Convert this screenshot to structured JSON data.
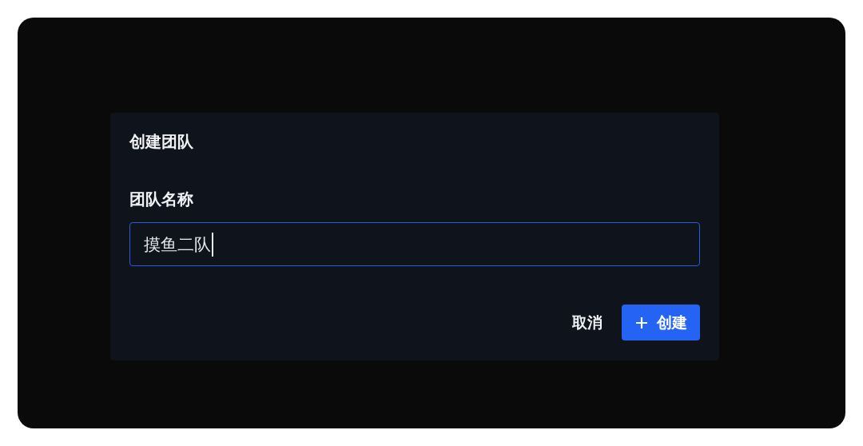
{
  "dialog": {
    "title": "创建团队",
    "field": {
      "label": "团队名称",
      "value": "摸鱼二队",
      "focused": true
    },
    "buttons": [
      {
        "kind": "text",
        "label": "取消"
      },
      {
        "kind": "primary",
        "label": "创建"
      }
    ]
  }
}
